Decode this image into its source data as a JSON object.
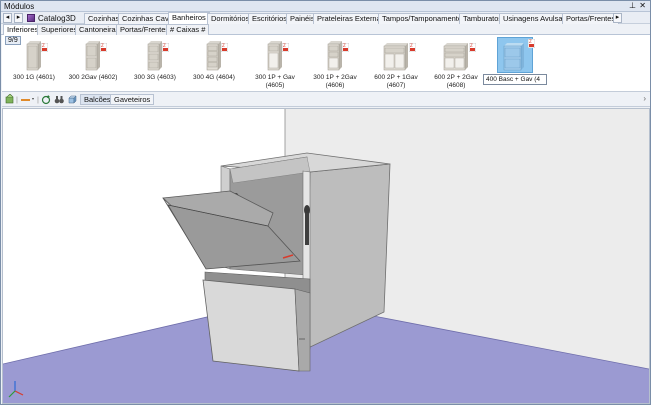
{
  "window": {
    "title": "Módulos",
    "pin_glyph": "⊥",
    "close_glyph": "✕"
  },
  "catalog": {
    "label": "Catalog3D",
    "nav_prev": "◂",
    "nav_next": "▸",
    "more": "▸"
  },
  "category_tabs": [
    {
      "label": "Cozinhas"
    },
    {
      "label": "Cozinhas Cava"
    },
    {
      "label": "Banheiros"
    },
    {
      "label": "Dormitórios"
    },
    {
      "label": "Escritórios"
    },
    {
      "label": "Painéis"
    },
    {
      "label": "Prateleiras Externas"
    },
    {
      "label": "Tampos/Tamponamentos"
    },
    {
      "label": "Tamburatos"
    },
    {
      "label": "Usinagens Avulsas"
    },
    {
      "label": "Portas/Frentes"
    }
  ],
  "active_category": "Banheiros",
  "sub_tabs": [
    {
      "label": "Inferiores"
    },
    {
      "label": "Superiores"
    },
    {
      "label": "Cantoneiras"
    },
    {
      "label": "Portas/Frentes"
    },
    {
      "label": "# Caixas #"
    }
  ],
  "active_sub_tab": "Inferiores",
  "gallery": {
    "counter": "9/9",
    "items": [
      {
        "label": "300 1G (4601)"
      },
      {
        "label": "300 2Gav (4602)"
      },
      {
        "label": "300 3G (4603)"
      },
      {
        "label": "300 4G (4604)"
      },
      {
        "label": "300 1P + Gav (4605)"
      },
      {
        "label": "300 1P + 2Gav (4606)"
      },
      {
        "label": "600 2P + 1Gav (4607)"
      },
      {
        "label": "600 2P + 2Gav (4608)"
      },
      {
        "label": "400 Basc + Gav (4"
      }
    ],
    "selected_index": 8
  },
  "toolbar": {
    "tabs": [
      {
        "label": "Balcões"
      },
      {
        "label": "Gaveteiros"
      }
    ],
    "active_tab": "Balcões",
    "scroll_glyph": "›"
  },
  "colors": {
    "floor": "#9b9ad2",
    "wall": "#e4e4e4",
    "cabinet": "#c9c9c9",
    "selected_bg": "#8ec6ee",
    "badge_red": "#d83b2c"
  }
}
